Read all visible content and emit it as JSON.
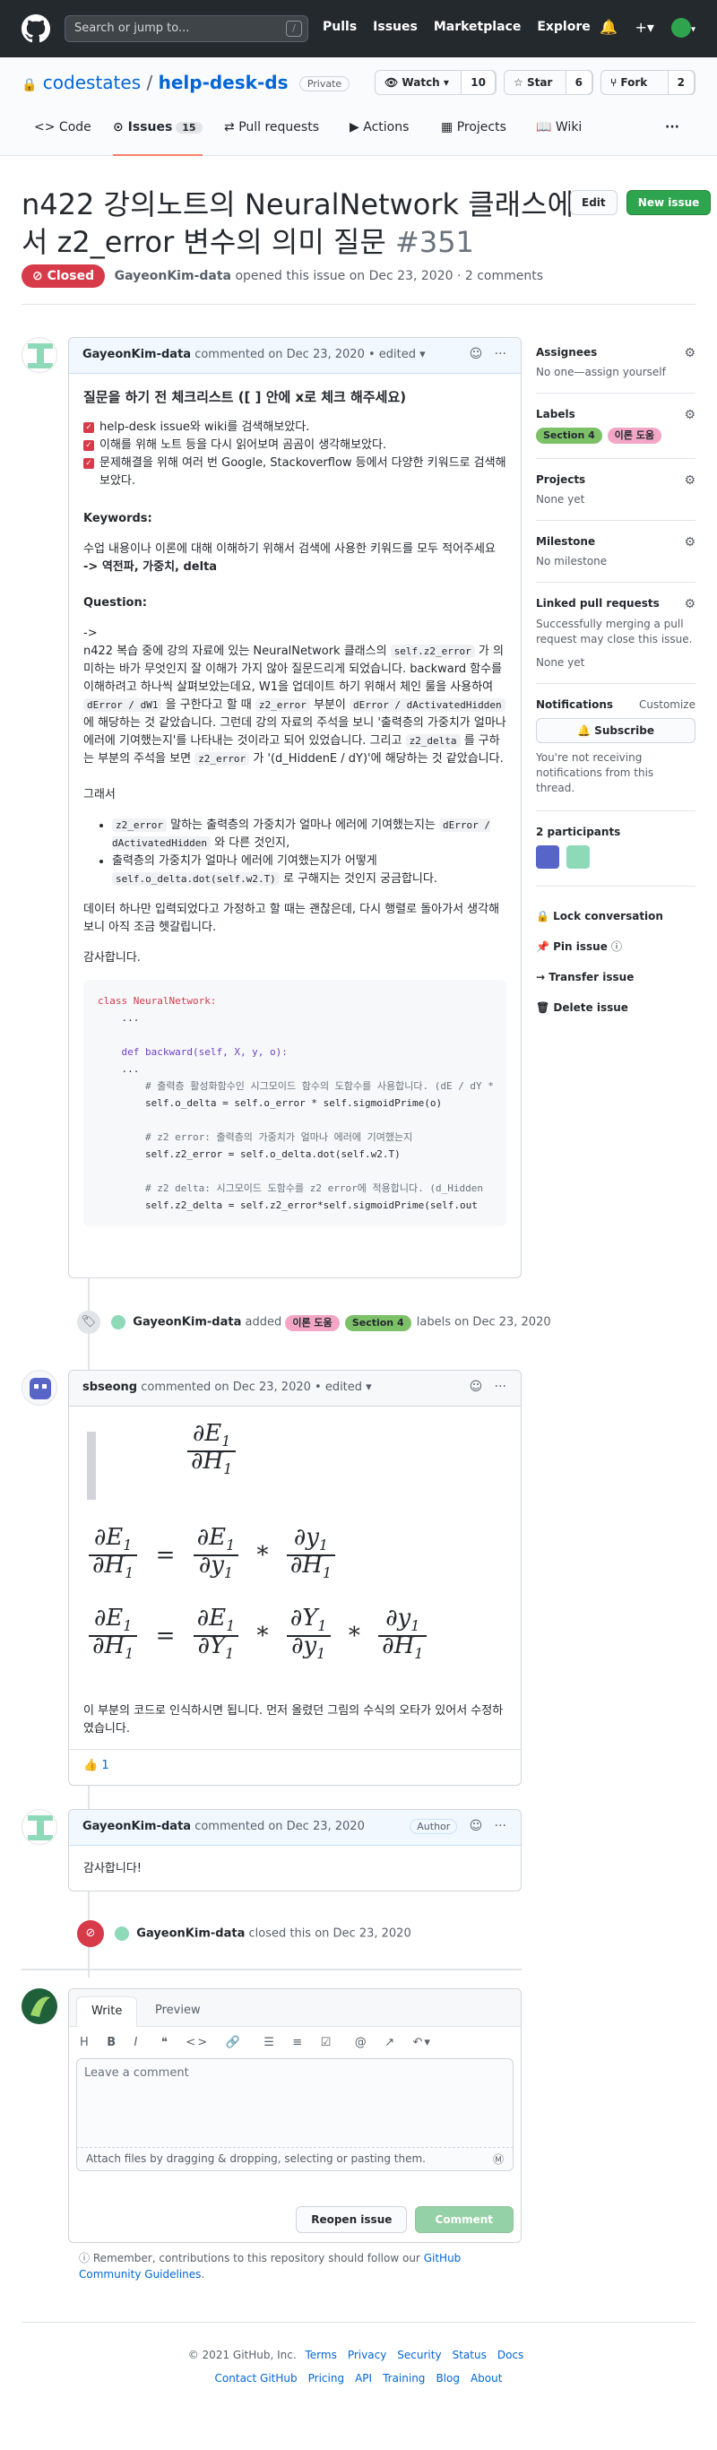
{
  "header": {
    "search_placeholder": "Search or jump to...",
    "slash": "/",
    "nav": [
      "Pulls",
      "Issues",
      "Marketplace",
      "Explore"
    ]
  },
  "repo": {
    "owner": "codestates",
    "sep": "/",
    "name": "help-desk-ds",
    "visibility": "Private",
    "watch_label": "Watch",
    "watch_count": "10",
    "star_label": "Star",
    "star_count": "6",
    "fork_label": "Fork",
    "fork_count": "2",
    "tabs": [
      {
        "label": "Code"
      },
      {
        "label": "Issues",
        "count": "15"
      },
      {
        "label": "Pull requests"
      },
      {
        "label": "Actions"
      },
      {
        "label": "Projects"
      },
      {
        "label": "Wiki"
      }
    ]
  },
  "issue": {
    "title": "n422 강의노트의 NeuralNetwork 클래스에서 z2_error 변수의 의미 질문",
    "number": "#351",
    "edit_label": "Edit",
    "new_issue_label": "New issue",
    "state": "Closed",
    "author": "GayeonKim-data",
    "meta": "opened this issue on Dec 23, 2020 · 2 comments"
  },
  "comment1": {
    "author": "GayeonKim-data",
    "meta": "commented on Dec 23, 2020 • edited",
    "heading": "질문을 하기 전 체크리스트 ([ ] 안에 x로 체크 해주세요)",
    "checks": [
      "help-desk issue와 wiki를 검색해보았다.",
      "이해를 위해 노트 등을 다시 읽어보며 곰곰이 생각해보았다.",
      "문제해결을 위해 여러 번 Google, Stackoverflow 등에서 다양한 키워드로 검색해보았다."
    ],
    "keywords_label": "Keywords:",
    "keywords_text": "수업 내용이나 이론에 대해 이해하기 위해서 검색에 사용한 키워드를 모두 적어주세요",
    "keywords_value": "-> 역전파, 가중치, delta",
    "question_label": "Question:",
    "arrow": "->",
    "q1": "n422 복습 중에 강의 자료에 있는 NeuralNetwork 클래스의",
    "q1_code": "self.z2_error",
    "q1b": "가 의미하는 바가 무엇인지 잘 이해가 가지 않아 질문드리게 되었습니다. backward 함수를 이해하려고 하나씩 살펴보았는데요, W1을 업데이트 하기 위해서 체인 룰을 사용하여",
    "q1_code2": "dError / dW1",
    "q1c": "을 구한다고 할 때",
    "q1_code3": "z2_error",
    "q1d": "부분이",
    "q1_code4": "dError / dActivatedHidden",
    "q1e": "에 해당하는 것 같았습니다. 그런데 강의 자료의 주석을 보니 '출력층의 가중치가 얼마나 에러에 기여했는지'를 나타내는 것이라고 되어 있었습니다. 그리고",
    "q1_code5": "z2_delta",
    "q1f": "를 구하는 부분의 주석을 보면",
    "q1_code6": "z2_error",
    "q1g": "가 '(d_HiddenE / dY)'에 해당하는 것 같았습니다.",
    "so": "그래서",
    "b1_code": "z2_error",
    "b1": "말하는 출력층의 가중치가 얼마나 에러에 기여했는지는",
    "b1_code2": "dError / dActivatedHidden",
    "b1b": "와 다른 것인지,",
    "b2": "출력층의 가중치가 얼마나 에러에 기여했는지가 어떻게",
    "b2_code": "self.o_delta.dot(self.w2.T)",
    "b2b": "로 구해지는 것인지 궁금합니다.",
    "p_data": "데이터 하나만 입력되었다고 가정하고 할 때는 괜찮은데, 다시 행렬로 돌아가서 생각해보니 아직 조금 헷갈립니다.",
    "thanks": "감사합니다.",
    "code_lines": [
      "class NeuralNetwork:",
      "    ...",
      "",
      "    def backward(self, X, y, o):",
      "    ...",
      "        # 출력층 활성화함수인 시그모이드 함수의 도함수를 사용합니다. (dE / dY *",
      "        self.o_delta = self.o_error * self.sigmoidPrime(o)",
      "",
      "        # z2 error: 출력층의 가중치가 얼마나 에러에 기여했는지",
      "        self.z2_error = self.o_delta.dot(self.w2.T)",
      "",
      "        # z2 delta: 시그모이드 도함수를 z2 error에 적용합니다. (d_Hidden",
      "        self.z2_delta = self.z2_error*self.sigmoidPrime(self.out"
    ]
  },
  "event_labels": {
    "author": "GayeonKim-data",
    "added": "added",
    "label_a": "이론 도움",
    "label_b": "Section 4",
    "suffix": "labels on Dec 23, 2020"
  },
  "comment2": {
    "author": "sbseong",
    "meta": "commented on Dec 23, 2020 • edited",
    "math": {
      "dE1": "∂E",
      "sub1": "1",
      "dH1": "∂H",
      "dy1": "∂y",
      "dY1": "∂Y",
      "eq": "=",
      "mul": "*"
    },
    "text": "이 부분의 코드로 인식하시면 됩니다. 먼저 올렸던 그림의 수식의 오타가 있어서 수정하였습니다.",
    "reaction": "👍",
    "reaction_count": "1"
  },
  "comment3": {
    "author": "GayeonKim-data",
    "meta": "commented on Dec 23, 2020",
    "badge": "Author",
    "text": "감사합니다!"
  },
  "event_closed": {
    "author": "GayeonKim-data",
    "text": "closed this on Dec 23, 2020"
  },
  "editor": {
    "tab_write": "Write",
    "tab_preview": "Preview",
    "placeholder": "Leave a comment",
    "attach": "Attach files by dragging & dropping, selecting or pasting them.",
    "reopen": "Reopen issue",
    "comment": "Comment",
    "note": "Remember, contributions to this repository should follow our",
    "note_link": "GitHub Community Guidelines",
    "note_end": "."
  },
  "sidebar": {
    "assignees_h": "Assignees",
    "assignees_v": "No one—assign yourself",
    "labels_h": "Labels",
    "labels": [
      {
        "name": "Section 4",
        "color": "#7cc068"
      },
      {
        "name": "이론 도움",
        "color": "#f3a6c6"
      }
    ],
    "projects_h": "Projects",
    "projects_v": "None yet",
    "milestone_h": "Milestone",
    "milestone_v": "No milestone",
    "linked_h": "Linked pull requests",
    "linked_v": "Successfully merging a pull request may close this issue.",
    "linked_v2": "None yet",
    "notif_h": "Notifications",
    "notif_custom": "Customize",
    "subscribe": "Subscribe",
    "notif_v": "You're not receiving notifications from this thread.",
    "participants_h": "2 participants",
    "actions": [
      "Lock conversation",
      "Pin issue",
      "Transfer issue",
      "Delete issue"
    ]
  },
  "footer": {
    "copyright": "© 2021 GitHub, Inc.",
    "links1": [
      "Terms",
      "Privacy",
      "Security",
      "Status",
      "Docs"
    ],
    "links2": [
      "Contact GitHub",
      "Pricing",
      "API",
      "Training",
      "Blog",
      "About"
    ]
  },
  "colors": {
    "closed": "#d73a49",
    "link": "#0366d6",
    "green": "#2ea44f",
    "label_section": "#7cc068",
    "label_theory": "#f3a6c6"
  }
}
